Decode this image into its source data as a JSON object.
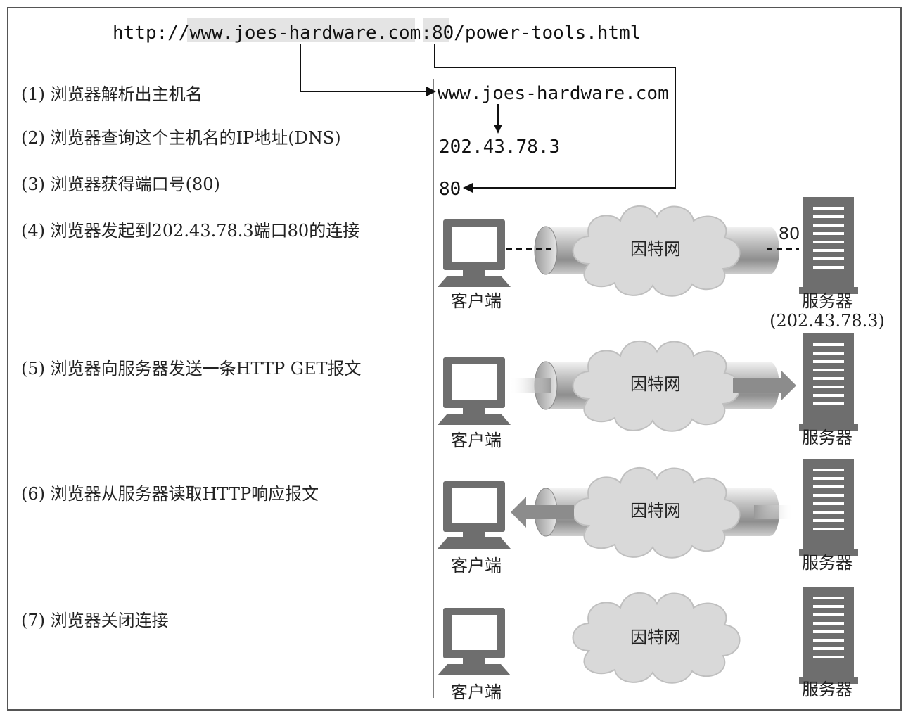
{
  "url": {
    "prefix": "http://",
    "host": "www.joes-hardware.com",
    "colon": ":",
    "port": "80",
    "path": "/power-tools.html"
  },
  "steps": [
    {
      "label": "(1) 浏览器解析出主机名"
    },
    {
      "label": "(2) 浏览器查询这个主机名的IP地址(DNS)"
    },
    {
      "label": "(3) 浏览器获得端口号(80)"
    },
    {
      "label": "(4) 浏览器发起到202.43.78.3端口80的连接"
    },
    {
      "label": "(5) 浏览器向服务器发送一条HTTP GET报文"
    },
    {
      "label": "(6) 浏览器从服务器读取HTTP响应报文"
    },
    {
      "label": "(7) 浏览器关闭连接"
    }
  ],
  "resolved": {
    "hostname": "www.joes-hardware.com",
    "ip": "202.43.78.3",
    "port": "80"
  },
  "labels": {
    "internet": "因特网",
    "client": "客户端",
    "server": "服务器",
    "server_ip": "(202.43.78.3)",
    "server_port": "80"
  },
  "colors": {
    "cloud_fill": "#d9d9d9",
    "device_fill": "#6e6e6e",
    "arrow_fill": "#8c8c8c",
    "highlight": "#e4e4e4"
  }
}
